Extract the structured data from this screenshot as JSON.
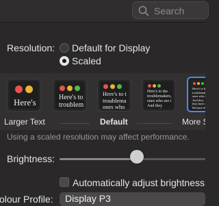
{
  "search": {
    "placeholder": "Search"
  },
  "resolution": {
    "label": "Resolution:",
    "options": [
      {
        "label": "Default for Display",
        "selected": false
      },
      {
        "label": "Scaled",
        "selected": true
      }
    ]
  },
  "scaling": {
    "thumbnails": [
      {
        "text": "Here's",
        "selected": false
      },
      {
        "text": "Here's to\ntroublem",
        "selected": false
      },
      {
        "text": "Here's to t\ntroublema\nones who",
        "selected": false
      },
      {
        "text": "Here's to the\ntroublemakers,\nones who see t\nAnd they",
        "selected": false
      },
      {
        "text": "Here's to the\ntroublemakers, the\nones who see things\nAnd they\nthey have no\nBecause the",
        "selected": true
      }
    ],
    "captions": {
      "left": "Larger Text",
      "center": "Default",
      "right": "More S"
    }
  },
  "note": "Using a scaled resolution may affect performance.",
  "brightness": {
    "label": "Brightness:",
    "value": 0.53
  },
  "auto_brightness": {
    "label": "Automatically adjust brightness",
    "checked": false
  },
  "color_profile": {
    "label": "olour Profile:",
    "value": "Display P3"
  },
  "colors": {
    "accent": "#4a8af0",
    "dot_red": "#e8544c",
    "dot_yellow": "#e9b43a",
    "dot_green": "#53b94b"
  }
}
